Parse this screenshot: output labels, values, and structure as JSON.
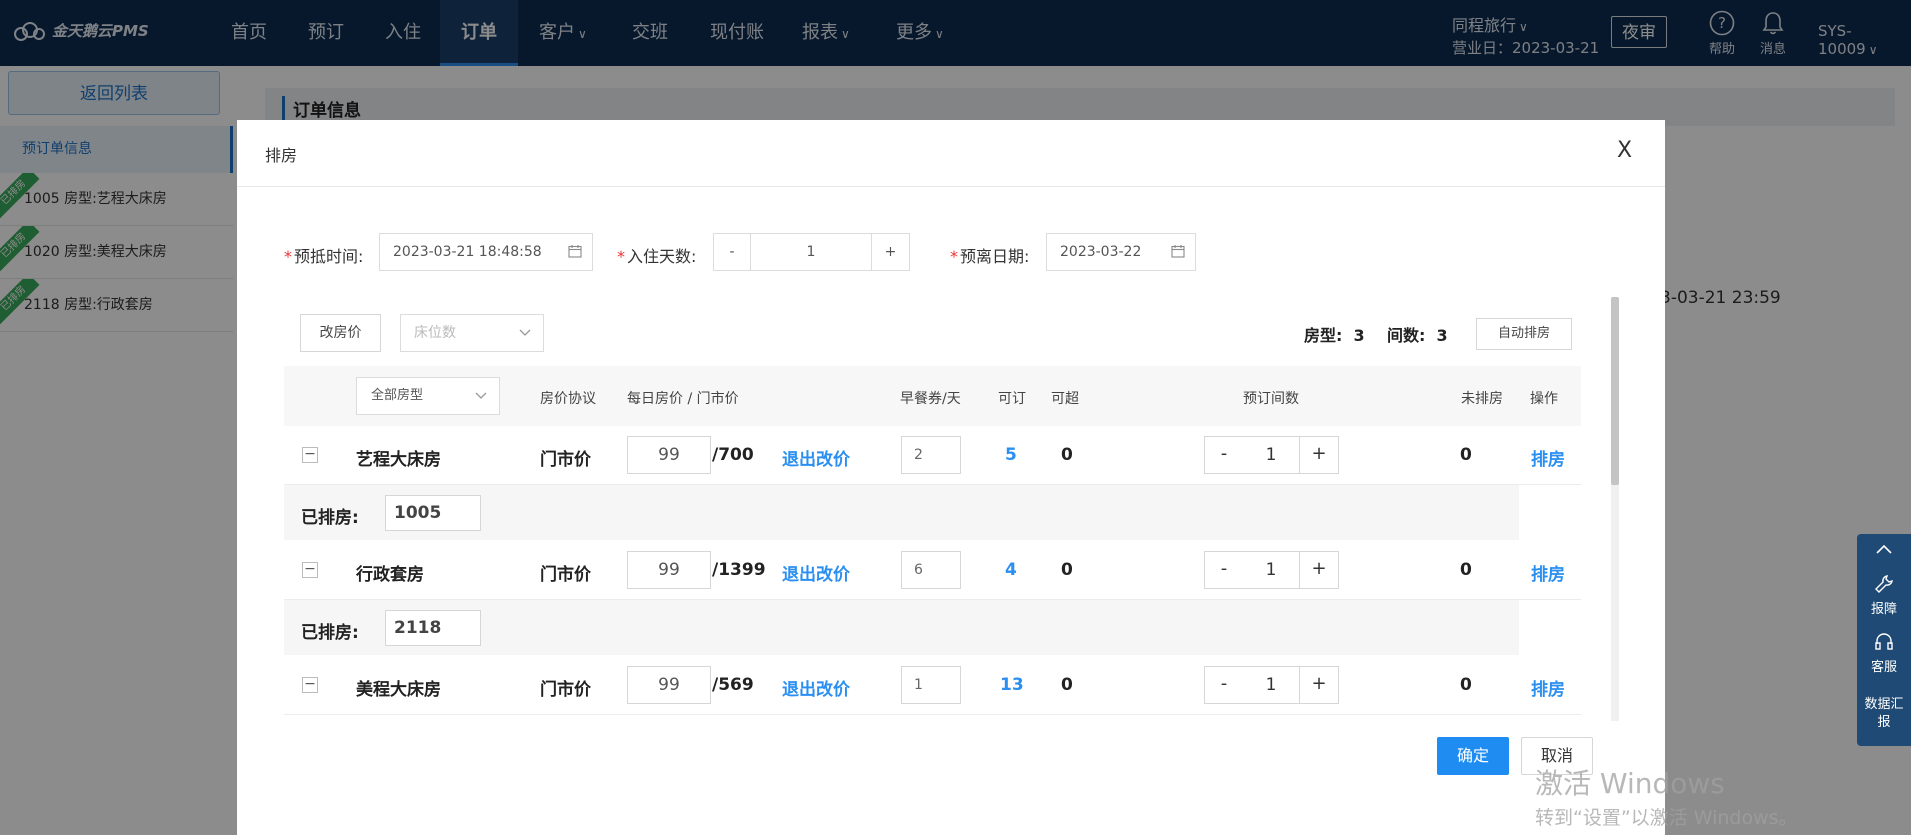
{
  "app": {
    "logo_text": "金天鹅云PMS",
    "nav": [
      "首页",
      "预订",
      "入住",
      "订单",
      "客户",
      "交班",
      "现付账",
      "报表",
      "更多"
    ],
    "active_nav": "订单",
    "hotel_name": "同程旅行",
    "business_date": "营业日：2023-03-21",
    "night_audit": "夜审",
    "help": "帮助",
    "messages": "消息",
    "user": "SYS-10009"
  },
  "sidebar": {
    "back_label": "返回列表",
    "section_label": "预订单信息",
    "rooms": [
      {
        "label": "1005  房型:艺程大床房",
        "badge": "已排房"
      },
      {
        "label": "1020  房型:美程大床房",
        "badge": "已排房"
      },
      {
        "label": "2118  房型:行政套房",
        "badge": "已排房"
      }
    ]
  },
  "background": {
    "header_title": "订单信息",
    "date_fragment": "3-03-21 23:59"
  },
  "float_panel": {
    "up": "^",
    "report": "报障",
    "service": "客服",
    "data": "数据汇报"
  },
  "modal": {
    "title": "排房",
    "close": "X",
    "arrival_label": "预抵时间:",
    "arrival_value": "2023-03-21 18:48:58",
    "nights_label": "入住天数:",
    "nights_value": "1",
    "minus": "-",
    "plus": "+",
    "departure_label": "预离日期:",
    "departure_value": "2023-03-22",
    "change_price": "改房价",
    "bed_count_placeholder": "床位数",
    "summary_type_label": "房型:",
    "summary_type_value": "3",
    "summary_rooms_label": "间数:",
    "summary_rooms_value": "3",
    "auto_assign": "自动排房",
    "headers": {
      "room_type_filter": "全部房型",
      "protocol": "房价协议",
      "daily_price": "每日房价 / 门市价",
      "breakfast": "早餐券/天",
      "available": "可订",
      "overbook": "可超",
      "booked_rooms": "预订间数",
      "unassigned": "未排房",
      "action": "操作"
    },
    "assigned_label": "已排房:",
    "rows": [
      {
        "room_type": "艺程大床房",
        "protocol": "门市价",
        "price": "99",
        "rack": "/700",
        "revert": "退出改价",
        "breakfast": "2",
        "available": "5",
        "overbook": "0",
        "qty": "1",
        "unassigned": "0",
        "action": "排房",
        "assigned": "1005"
      },
      {
        "room_type": "行政套房",
        "protocol": "门市价",
        "price": "99",
        "rack": "/1399",
        "revert": "退出改价",
        "breakfast": "6",
        "available": "4",
        "overbook": "0",
        "qty": "1",
        "unassigned": "0",
        "action": "排房",
        "assigned": "2118"
      },
      {
        "room_type": "美程大床房",
        "protocol": "门市价",
        "price": "99",
        "rack": "/569",
        "revert": "退出改价",
        "breakfast": "1",
        "available": "13",
        "overbook": "0",
        "qty": "1",
        "unassigned": "0",
        "action": "排房",
        "assigned": ""
      }
    ],
    "ok": "确定",
    "cancel": "取消"
  },
  "watermark": {
    "line1": "激活 Windows",
    "line2": "转到“设置”以激活 Windows。"
  },
  "colors": {
    "nav_bg": "#0d2d52",
    "accent": "#1e8cf0",
    "badge_green": "#3aa95b"
  }
}
